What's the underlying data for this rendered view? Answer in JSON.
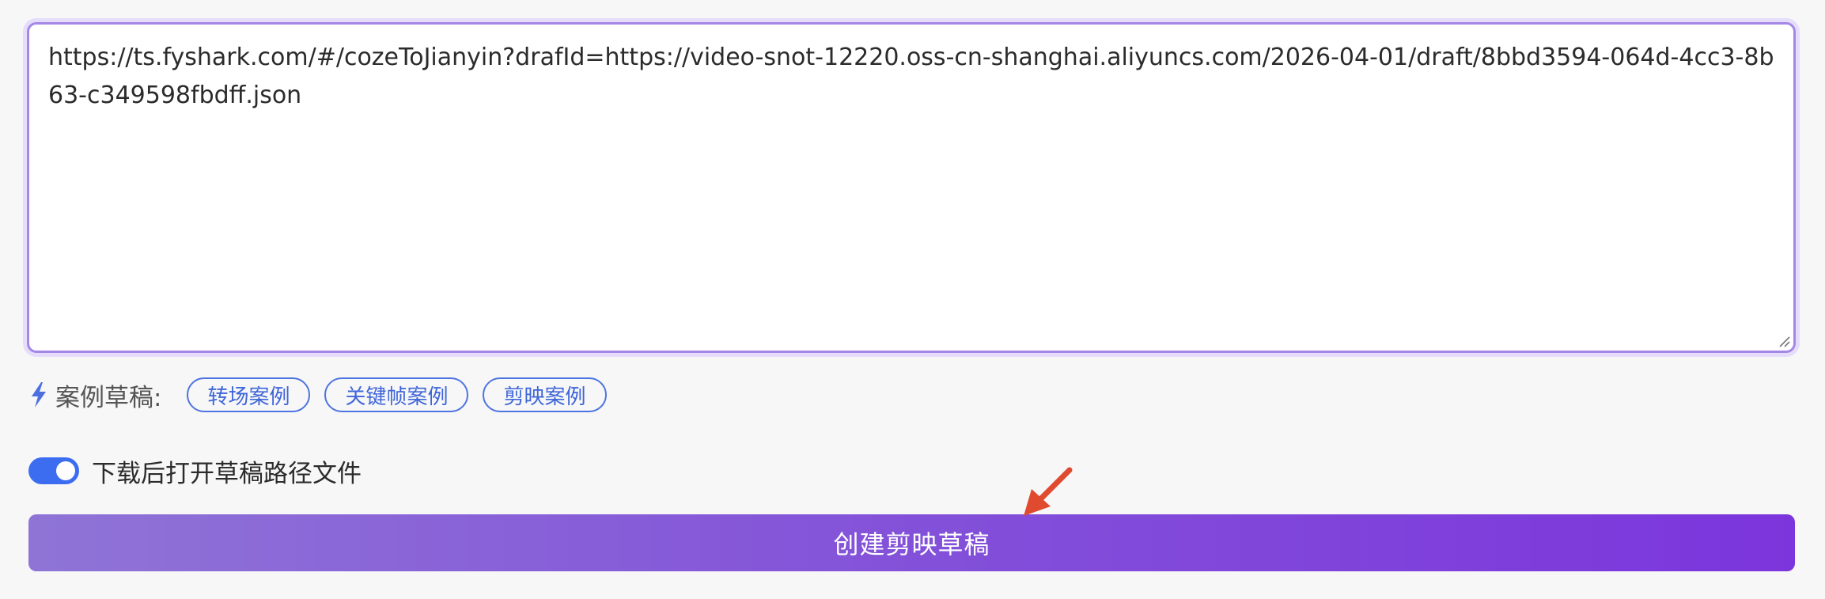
{
  "url_input": {
    "value": "https://ts.fyshark.com/#/cozeToJianyin?drafId=https://video-snot-12220.oss-cn-shanghai.aliyuncs.com/2026-04-01/draft/8bbd3594-064d-4cc3-8b63-c349598fbdff.json"
  },
  "examples": {
    "icon": "lightning-bolt-icon",
    "label": "案例草稿:",
    "items": [
      {
        "label": "转场案例"
      },
      {
        "label": "关键帧案例"
      },
      {
        "label": "剪映案例"
      }
    ]
  },
  "toggle": {
    "label": "下载后打开草稿路径文件",
    "checked": true
  },
  "create_button": {
    "label": "创建剪映草稿"
  },
  "colors": {
    "accent_blue": "#3c6df0",
    "chip_blue": "#4d74e0",
    "button_gradient_start": "#8f74d6",
    "button_gradient_end": "#7c35dc",
    "focus_border": "#a487e6",
    "annotation_arrow": "#e04a2f"
  }
}
